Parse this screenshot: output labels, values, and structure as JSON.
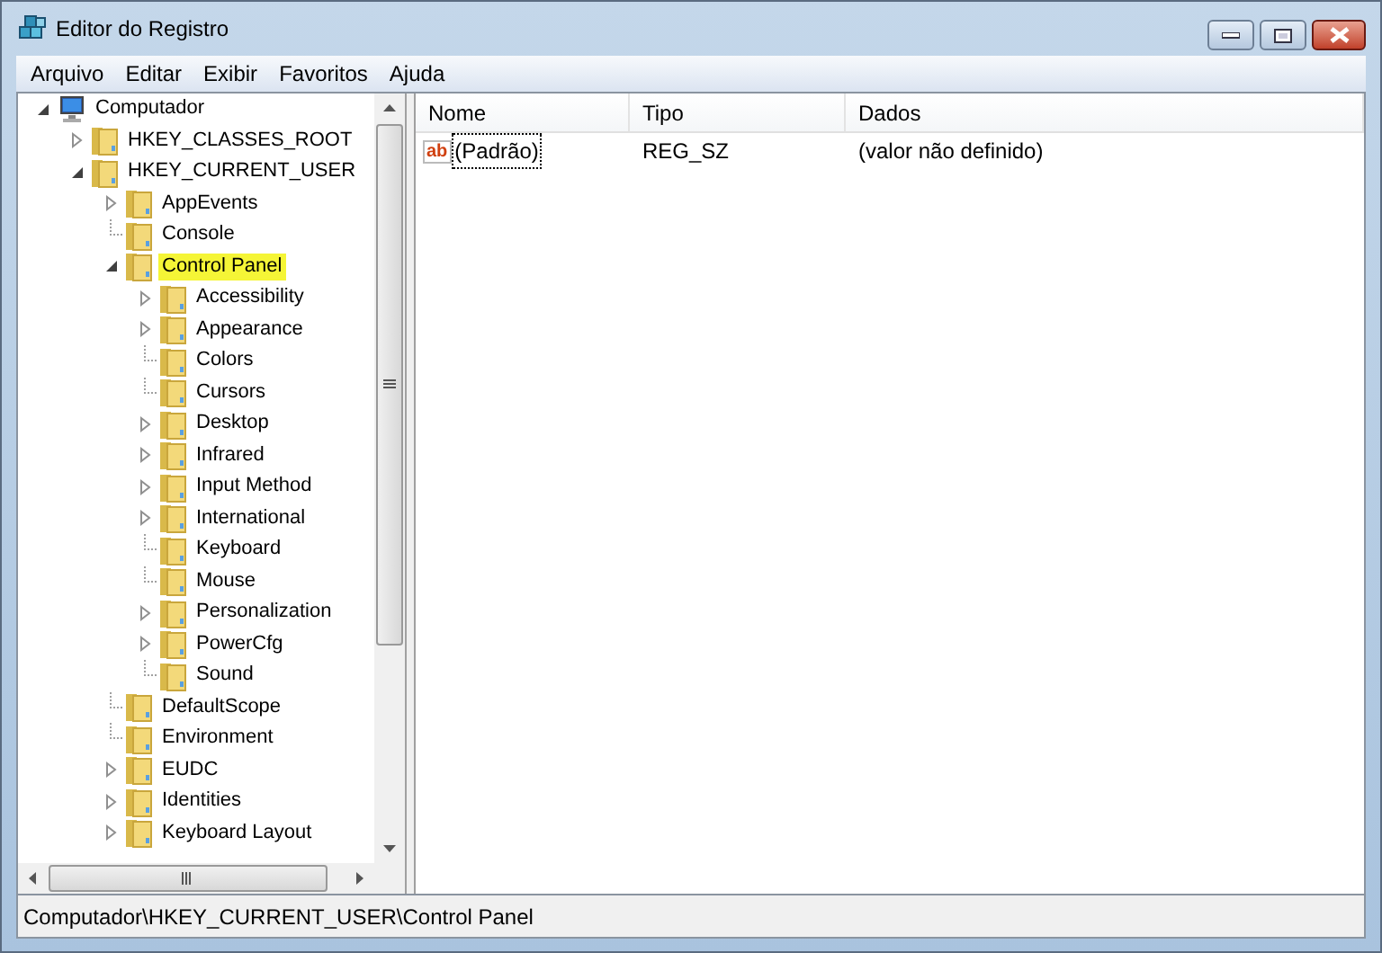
{
  "window": {
    "title": "Editor do Registro"
  },
  "menu": [
    "Arquivo",
    "Editar",
    "Exibir",
    "Favoritos",
    "Ajuda"
  ],
  "tree": [
    {
      "label": "Computador",
      "kind": "computer",
      "expanded": true,
      "selected": false,
      "children": [
        {
          "label": "HKEY_CLASSES_ROOT",
          "kind": "folder",
          "expanded": false,
          "selected": false
        },
        {
          "label": "HKEY_CURRENT_USER",
          "kind": "folder",
          "expanded": true,
          "selected": false,
          "children": [
            {
              "label": "AppEvents",
              "kind": "folder",
              "expanded": false,
              "selected": false
            },
            {
              "label": "Console",
              "kind": "folder",
              "selected": false
            },
            {
              "label": "Control Panel",
              "kind": "folder",
              "expanded": true,
              "selected": true,
              "children": [
                {
                  "label": "Accessibility",
                  "kind": "folder",
                  "expanded": false,
                  "selected": false
                },
                {
                  "label": "Appearance",
                  "kind": "folder",
                  "expanded": false,
                  "selected": false
                },
                {
                  "label": "Colors",
                  "kind": "folder",
                  "selected": false
                },
                {
                  "label": "Cursors",
                  "kind": "folder",
                  "selected": false
                },
                {
                  "label": "Desktop",
                  "kind": "folder",
                  "expanded": false,
                  "selected": false
                },
                {
                  "label": "Infrared",
                  "kind": "folder",
                  "expanded": false,
                  "selected": false
                },
                {
                  "label": "Input Method",
                  "kind": "folder",
                  "expanded": false,
                  "selected": false
                },
                {
                  "label": "International",
                  "kind": "folder",
                  "expanded": false,
                  "selected": false
                },
                {
                  "label": "Keyboard",
                  "kind": "folder",
                  "selected": false
                },
                {
                  "label": "Mouse",
                  "kind": "folder",
                  "selected": false
                },
                {
                  "label": "Personalization",
                  "kind": "folder",
                  "expanded": false,
                  "selected": false
                },
                {
                  "label": "PowerCfg",
                  "kind": "folder",
                  "expanded": false,
                  "selected": false
                },
                {
                  "label": "Sound",
                  "kind": "folder",
                  "selected": false
                }
              ]
            },
            {
              "label": "DefaultScope",
              "kind": "folder",
              "selected": false
            },
            {
              "label": "Environment",
              "kind": "folder",
              "selected": false
            },
            {
              "label": "EUDC",
              "kind": "folder",
              "expanded": false,
              "selected": false
            },
            {
              "label": "Identities",
              "kind": "folder",
              "expanded": false,
              "selected": false
            },
            {
              "label": "Keyboard Layout",
              "kind": "folder",
              "expanded": false,
              "selected": false
            }
          ]
        }
      ]
    }
  ],
  "table": {
    "columns": [
      "Nome",
      "Tipo",
      "Dados"
    ],
    "rows": [
      {
        "icon_text": "ab",
        "name": "(Padrão)",
        "type": "REG_SZ",
        "data": "(valor não definido)",
        "focused": true
      }
    ]
  },
  "status_bar": "Computador\\HKEY_CURRENT_USER\\Control Panel"
}
